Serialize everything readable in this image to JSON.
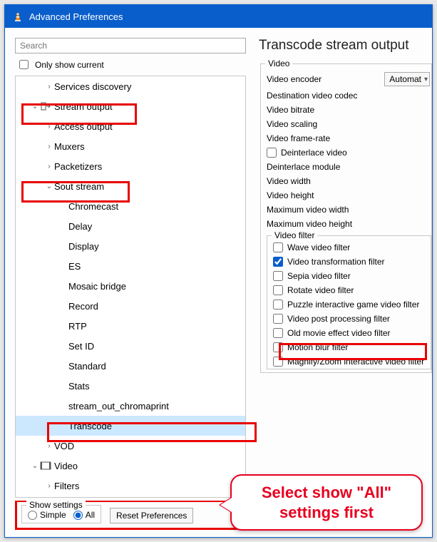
{
  "window": {
    "title": "Advanced Preferences"
  },
  "search": {
    "placeholder": "Search"
  },
  "only_show_current": "Only show current",
  "tree": {
    "services_discovery": "Services discovery",
    "stream_output": "Stream output",
    "access_output": "Access output",
    "muxers": "Muxers",
    "packetizers": "Packetizers",
    "sout_stream": "Sout stream",
    "chromecast": "Chromecast",
    "delay": "Delay",
    "display": "Display",
    "es": "ES",
    "mosaic_bridge": "Mosaic bridge",
    "record": "Record",
    "rtp": "RTP",
    "set_id": "Set ID",
    "standard": "Standard",
    "stats": "Stats",
    "stream_out_chromaprint": "stream_out_chromaprint",
    "transcode": "Transcode",
    "vod": "VOD",
    "video": "Video",
    "filters": "Filters"
  },
  "rhs": {
    "title": "Transcode stream output",
    "video_group": "Video",
    "video_encoder": "Video encoder",
    "video_encoder_value": "Automat",
    "dest_codec": "Destination video codec",
    "bitrate": "Video bitrate",
    "scaling": "Video scaling",
    "framerate": "Video frame-rate",
    "deinterlace": "Deinterlace video",
    "deinterlace_module": "Deinterlace module",
    "width": "Video width",
    "height": "Video height",
    "max_width": "Maximum video width",
    "max_height": "Maximum video height",
    "video_filter_group": "Video filter",
    "wave": "Wave video filter",
    "transform": "Video transformation filter",
    "sepia": "Sepia video filter",
    "rotate": "Rotate video filter",
    "puzzle": "Puzzle interactive game video filter",
    "postproc": "Video post processing filter",
    "oldmovie": "Old movie effect video filter",
    "motionblur": "Motion blur filter",
    "magnify": "Magnify/Zoom interactive video filter"
  },
  "bottom": {
    "show_settings": "Show settings",
    "simple": "Simple",
    "all": "All",
    "reset": "Reset Preferences"
  },
  "callout": {
    "line1": "Select show \"All\"",
    "line2": "settings first"
  },
  "chart_data": null
}
